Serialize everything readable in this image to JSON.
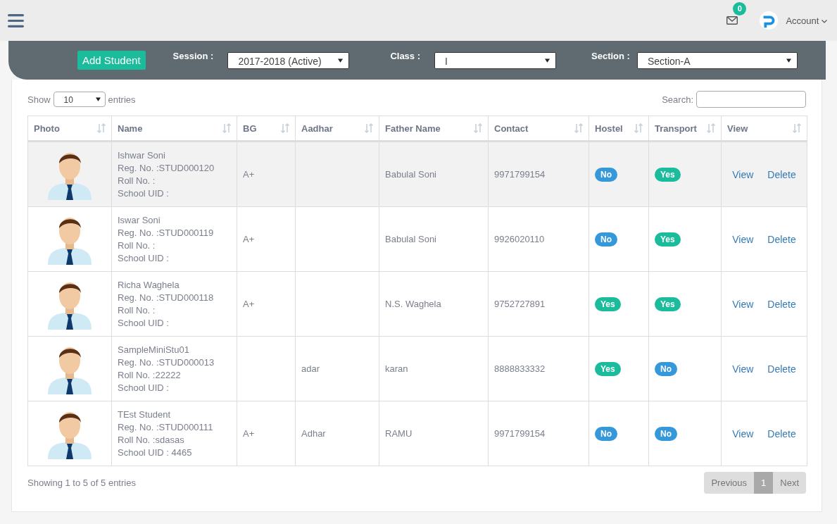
{
  "topbar": {
    "notifications": "0",
    "account": "Account"
  },
  "filters": {
    "add_button": "Add Student",
    "session_label": "Session :",
    "session": "2017-2018 (Active)",
    "class_label": "Class :",
    "class": "I",
    "section_label": "Section :",
    "section": "Section-A"
  },
  "controls": {
    "show": "Show",
    "page_length": "10",
    "entries": "entries",
    "search_label": "Search:"
  },
  "table": {
    "columns": [
      "Photo",
      "Name",
      "BG",
      "Aadhar",
      "Father Name",
      "Contact",
      "Hostel",
      "Transport",
      "View"
    ],
    "rows": [
      {
        "hovered": true,
        "name": "Ishwar Soni",
        "reg": "Reg. No. :STUD000120",
        "roll": "Roll No. :",
        "uid": "School UID :",
        "bg": "A+",
        "aadhar": "",
        "father": "Babulal Soni",
        "contact": "9971799154",
        "hostel": {
          "label": "No",
          "color": "#3498db"
        },
        "transport": {
          "label": "Yes",
          "color": "#1abc9c"
        },
        "view": "View",
        "delete": "Delete"
      },
      {
        "hovered": false,
        "name": "Iswar Soni",
        "reg": "Reg. No. :STUD000119",
        "roll": "Roll No. :",
        "uid": "School UID :",
        "bg": "A+",
        "aadhar": "",
        "father": "Babulal Soni",
        "contact": "9926020110",
        "hostel": {
          "label": "No",
          "color": "#3498db"
        },
        "transport": {
          "label": "Yes",
          "color": "#1abc9c"
        },
        "view": "View",
        "delete": "Delete"
      },
      {
        "hovered": false,
        "name": "Richa Waghela",
        "reg": "Reg. No. :STUD000118",
        "roll": "Roll No. :",
        "uid": "School UID :",
        "bg": "A+",
        "aadhar": "",
        "father": "N.S. Waghela",
        "contact": "9752727891",
        "hostel": {
          "label": "Yes",
          "color": "#1abc9c"
        },
        "transport": {
          "label": "Yes",
          "color": "#1abc9c"
        },
        "view": "View",
        "delete": "Delete"
      },
      {
        "hovered": false,
        "name": "SampleMiniStu01",
        "reg": "Reg. No. :STUD000013",
        "roll": "Roll No. :22222",
        "uid": "School UID :",
        "bg": "",
        "aadhar": "adar",
        "father": "karan",
        "contact": "8888833332",
        "hostel": {
          "label": "Yes",
          "color": "#1abc9c"
        },
        "transport": {
          "label": "No",
          "color": "#3498db"
        },
        "view": "View",
        "delete": "Delete"
      },
      {
        "hovered": false,
        "name": "TEst Student",
        "reg": "Reg. No. :STUD000111",
        "roll": "Roll No. :sdasas",
        "uid": "School UID : 4465",
        "bg": "A+",
        "aadhar": "Adhar",
        "father": "RAMU",
        "contact": "9971799154",
        "hostel": {
          "label": "No",
          "color": "#3498db"
        },
        "transport": {
          "label": "No",
          "color": "#3498db"
        },
        "view": "View",
        "delete": "Delete"
      }
    ]
  },
  "footer": {
    "info": "Showing 1 to 5 of 5 entries",
    "previous": "Previous",
    "pages": [
      {
        "label": "1",
        "selected": true
      }
    ],
    "next": "Next"
  }
}
